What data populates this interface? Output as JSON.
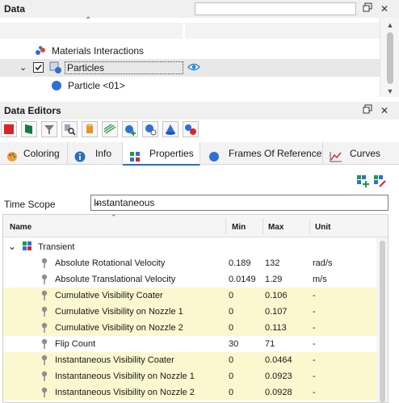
{
  "data_panel": {
    "title": "Data",
    "tree": [
      {
        "label": "Materials Interactions",
        "icon": "materials-interactions-icon"
      },
      {
        "label": "Particles",
        "icon": "particles-icon",
        "checked": true,
        "expanded": true,
        "selected": true
      },
      {
        "label": "Particle <01>",
        "icon": "particle-sphere-icon"
      }
    ]
  },
  "editors": {
    "title": "Data Editors",
    "toolbar": [
      "red-cube-icon",
      "green-surface-icon",
      "funnel-icon",
      "search-particles-icon",
      "cylinder-icon",
      "stripes-icon",
      "add-particle-icon",
      "particle-settings-icon",
      "cone-icon",
      "particles-group-icon"
    ],
    "tabs": [
      {
        "label": "Coloring",
        "icon": "palette-icon"
      },
      {
        "label": "Info",
        "icon": "info-icon"
      },
      {
        "label": "Properties",
        "icon": "properties-icon",
        "active": true
      },
      {
        "label": "Frames Of Reference",
        "icon": "frames-icon"
      },
      {
        "label": "Curves",
        "icon": "curves-icon"
      }
    ],
    "time_scope_label": "Time Scope",
    "time_scope_value": "Instantaneous",
    "columns": [
      "Name",
      "Min",
      "Max",
      "Unit"
    ],
    "group": "Transient",
    "rows": [
      {
        "name": "Absolute Rotational Velocity",
        "min": "0.189",
        "max": "132",
        "unit": "rad/s",
        "hl": false
      },
      {
        "name": "Absolute Translational Velocity",
        "min": "0.0149",
        "max": "1.29",
        "unit": "m/s",
        "hl": false
      },
      {
        "name": "Cumulative Visibility Coater",
        "min": "0",
        "max": "0.106",
        "unit": "-",
        "hl": true
      },
      {
        "name": "Cumulative Visibility on Nozzle 1",
        "min": "0",
        "max": "0.107",
        "unit": "-",
        "hl": true
      },
      {
        "name": "Cumulative Visibility on Nozzle 2",
        "min": "0",
        "max": "0.113",
        "unit": "-",
        "hl": true
      },
      {
        "name": "Flip Count",
        "min": "30",
        "max": "71",
        "unit": "-",
        "hl": false
      },
      {
        "name": "Instantaneous Visibility Coater",
        "min": "0",
        "max": "0.0464",
        "unit": "-",
        "hl": true
      },
      {
        "name": "Instantaneous Visibility on Nozzle 1",
        "min": "0",
        "max": "0.0923",
        "unit": "-",
        "hl": true
      },
      {
        "name": "Instantaneous Visibility on Nozzle 2",
        "min": "0",
        "max": "0.0928",
        "unit": "-",
        "hl": true
      }
    ]
  },
  "colors": {
    "accent": "#2a6ebb",
    "highlight": "#fbf8cf"
  }
}
